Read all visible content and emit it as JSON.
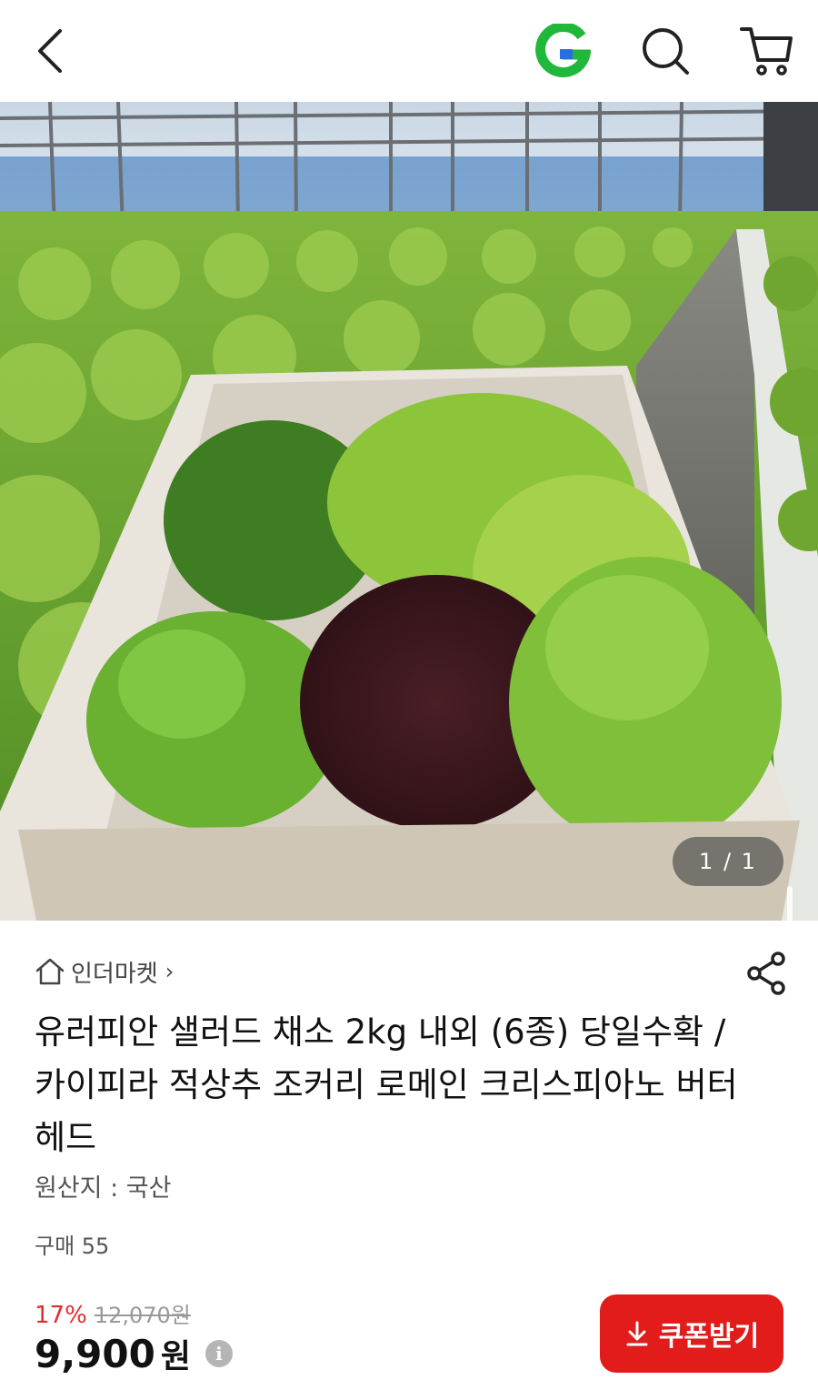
{
  "header": {
    "back_icon": "chevron-left-icon",
    "logo_icon": "g-logo-icon",
    "search_icon": "search-icon",
    "cart_icon": "cart-icon",
    "logo_colors": {
      "green": "#1fb83b",
      "blue": "#2a6fe0"
    }
  },
  "gallery": {
    "counter": "1 / 1"
  },
  "product": {
    "store_name": "인더마켓",
    "store_chevron": "›",
    "title": "유러피안 샐러드 채소 2kg 내외 (6종) 당일수확 / 카이피라 적상추 조커리 로메인 크리스피아노 버터헤드",
    "origin": "원산지 : 국산",
    "purchase": "구매 55",
    "discount": "17%",
    "original_price": "12,070원",
    "price": "9,900",
    "price_unit": "원",
    "info_glyph": "i"
  },
  "coupon": {
    "label": "쿠폰받기",
    "icon": "download-arrow-icon",
    "color": "#e21b1b"
  }
}
